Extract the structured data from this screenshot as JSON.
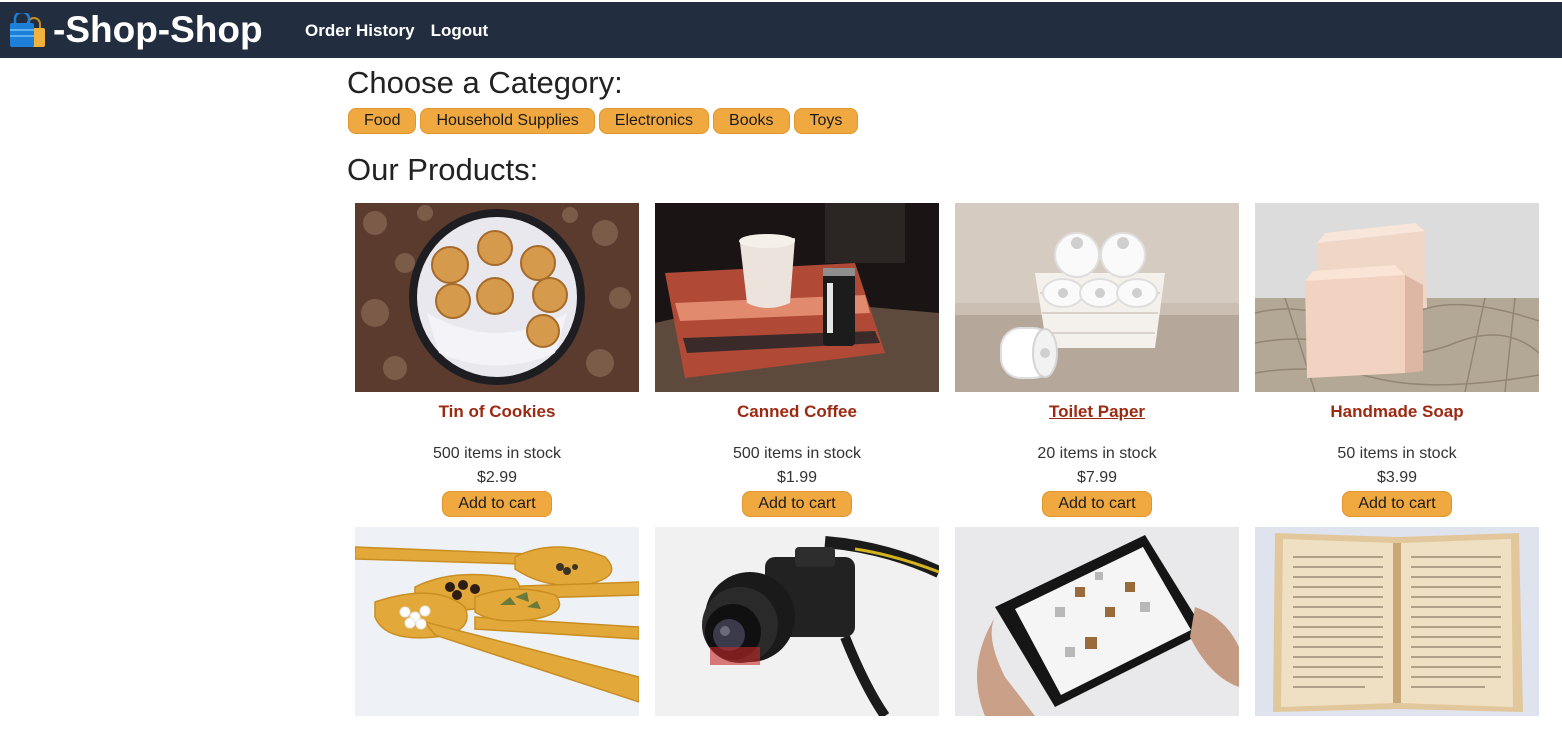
{
  "header": {
    "brand": "-Shop-Shop",
    "logo_icon": "shopping-bags-icon",
    "nav": [
      {
        "label": "Order History"
      },
      {
        "label": "Logout"
      }
    ]
  },
  "categories": {
    "title": "Choose a Category:",
    "items": [
      "Food",
      "Household Supplies",
      "Electronics",
      "Books",
      "Toys"
    ]
  },
  "products": {
    "title": "Our Products:",
    "items": [
      {
        "name": "Tin of Cookies",
        "stock": "500 items in stock",
        "price": "$2.99",
        "button": "Add to cart",
        "image": "cookies-tin-photo"
      },
      {
        "name": "Canned Coffee",
        "stock": "500 items in stock",
        "price": "$1.99",
        "button": "Add to cart",
        "image": "canned-coffee-photo"
      },
      {
        "name": "Toilet Paper",
        "stock": "20 items in stock",
        "price": "$7.99",
        "button": "Add to cart",
        "image": "toilet-paper-photo"
      },
      {
        "name": "Handmade Soap",
        "stock": "50 items in stock",
        "price": "$3.99",
        "button": "Add to cart",
        "image": "soap-photo"
      },
      {
        "image": "wooden-spoons-spices-photo"
      },
      {
        "image": "camera-photo"
      },
      {
        "image": "tablet-photo"
      },
      {
        "image": "open-book-photo"
      }
    ]
  },
  "colors": {
    "topbar": "#222e3f",
    "accent_button": "#f0a841",
    "product_name": "#9b2a12"
  }
}
